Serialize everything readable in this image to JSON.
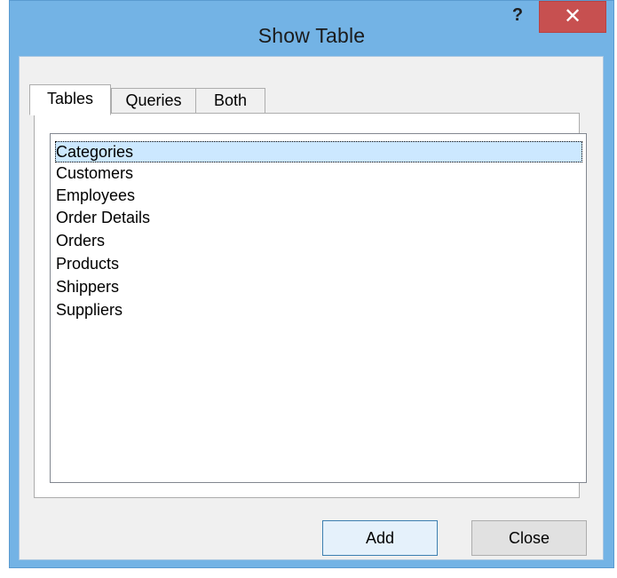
{
  "window": {
    "title": "Show Table",
    "help_glyph": "?",
    "close_glyph": "✕"
  },
  "tabs": [
    {
      "label": "Tables",
      "active": true
    },
    {
      "label": "Queries",
      "active": false
    },
    {
      "label": "Both",
      "active": false
    }
  ],
  "list": {
    "items": [
      "Categories",
      "Customers",
      "Employees",
      "Order Details",
      "Orders",
      "Products",
      "Shippers",
      "Suppliers"
    ],
    "selected_index": 0
  },
  "buttons": {
    "add_label": "Add",
    "close_label": "Close"
  },
  "colors": {
    "frame": "#73b3e5",
    "close_button": "#c75050",
    "selection": "#cce8ff"
  }
}
